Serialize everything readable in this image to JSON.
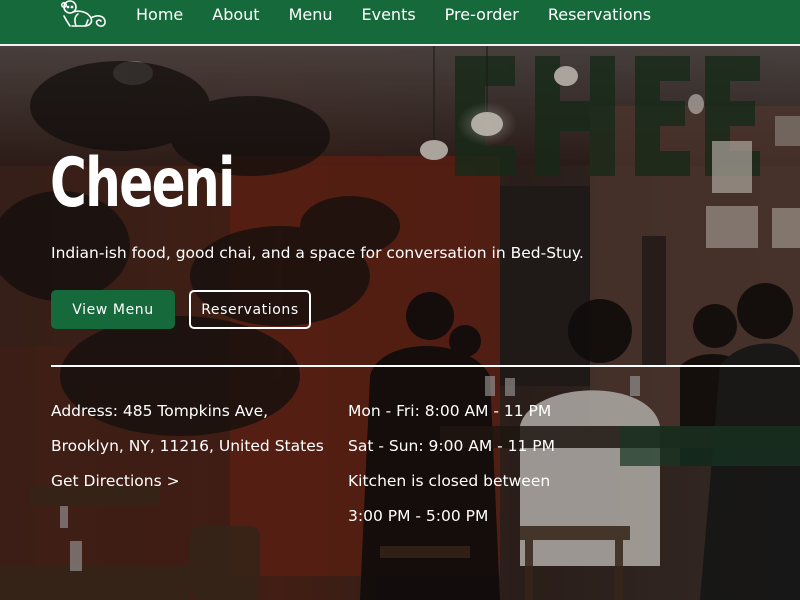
{
  "nav": {
    "logo_icon": "monkey-logo-icon",
    "items": [
      {
        "label": "Home"
      },
      {
        "label": "About"
      },
      {
        "label": "Menu"
      },
      {
        "label": "Events"
      },
      {
        "label": "Pre-order"
      },
      {
        "label": "Reservations"
      }
    ],
    "background": "#16693a"
  },
  "hero": {
    "title": "Cheeni",
    "tagline": "Indian-ish food, good chai, and a space for conversation in Bed-Stuy.",
    "primary_button": "View Menu",
    "secondary_button": "Reservations"
  },
  "info": {
    "address_line1": "Address: 485 Tompkins Ave,",
    "address_line2": "Brooklyn, NY, 11216, United States",
    "directions_link": "Get Directions >",
    "hours_line1": "Mon - Fri: 8:00 AM - 11 PM",
    "hours_line2": "Sat - Sun: 9:00 AM - 11 PM",
    "hours_line3": "Kitchen is closed between",
    "hours_line4": "3:00 PM - 5:00 PM"
  },
  "colors": {
    "brand_green": "#16693a",
    "text": "#ffffff"
  }
}
